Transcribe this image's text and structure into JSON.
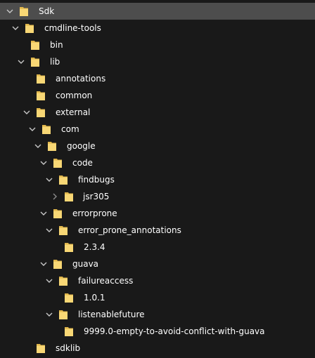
{
  "tree": {
    "items": [
      {
        "label": "Sdk",
        "state": "expanded",
        "selected": true
      },
      {
        "label": "cmdline-tools",
        "state": "expanded"
      },
      {
        "label": "bin",
        "state": "leaf"
      },
      {
        "label": "lib",
        "state": "expanded"
      },
      {
        "label": "annotations",
        "state": "leaf"
      },
      {
        "label": "common",
        "state": "leaf"
      },
      {
        "label": "external",
        "state": "expanded"
      },
      {
        "label": "com",
        "state": "expanded"
      },
      {
        "label": "google",
        "state": "expanded"
      },
      {
        "label": "code",
        "state": "expanded"
      },
      {
        "label": "findbugs",
        "state": "expanded"
      },
      {
        "label": "jsr305",
        "state": "collapsed"
      },
      {
        "label": "errorprone",
        "state": "expanded"
      },
      {
        "label": "error_prone_annotations",
        "state": "expanded"
      },
      {
        "label": "2.3.4",
        "state": "leaf"
      },
      {
        "label": "guava",
        "state": "expanded"
      },
      {
        "label": "failureaccess",
        "state": "expanded"
      },
      {
        "label": "1.0.1",
        "state": "leaf"
      },
      {
        "label": "listenablefuture",
        "state": "expanded"
      },
      {
        "label": "9999.0-empty-to-avoid-conflict-with-guava",
        "state": "leaf"
      },
      {
        "label": "sdklib",
        "state": "leaf"
      }
    ]
  },
  "colors": {
    "background": "#191919",
    "selection": "#4d4d4d",
    "folder": "#f8d775",
    "folder_dark": "#e0b64a",
    "chevron_expanded": "#c8c8c8",
    "chevron_collapsed": "#8a8a8a",
    "text": "#ffffff"
  },
  "icons": {
    "folder": "folder-icon",
    "expanded": "chevron-down-icon",
    "collapsed": "chevron-right-icon"
  }
}
